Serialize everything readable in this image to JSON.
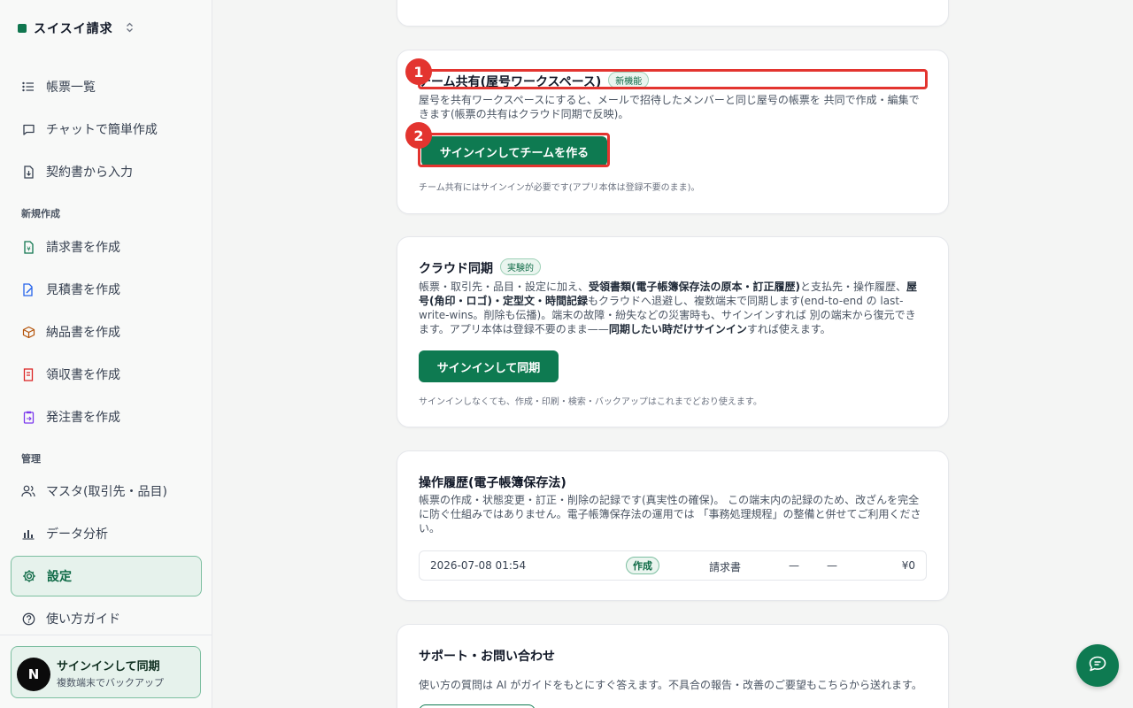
{
  "brand": {
    "name": "スイスイ請求",
    "chevron": "⌃⌄"
  },
  "sidebar": {
    "items": [
      {
        "label": "帳票一覧",
        "icon": "list-icon"
      },
      {
        "label": "チャットで簡単作成",
        "icon": "chat-icon"
      },
      {
        "label": "契約書から入力",
        "icon": "document-import-icon"
      }
    ],
    "section_new": "新規作成",
    "new_items": [
      {
        "label": "請求書を作成",
        "icon": "invoice-icon"
      },
      {
        "label": "見積書を作成",
        "icon": "quote-icon"
      },
      {
        "label": "納品書を作成",
        "icon": "box-icon"
      },
      {
        "label": "領収書を作成",
        "icon": "receipt-icon"
      },
      {
        "label": "発注書を作成",
        "icon": "order-icon"
      }
    ],
    "section_manage": "管理",
    "manage_items": [
      {
        "label": "マスタ(取引先・品目)",
        "icon": "users-icon"
      },
      {
        "label": "データ分析",
        "icon": "bar-chart-icon"
      },
      {
        "label": "設定",
        "icon": "gear-icon",
        "active": true
      },
      {
        "label": "使い方ガイド",
        "icon": "help-icon"
      }
    ],
    "signin": {
      "avatar": "N",
      "title": "サインインして同期",
      "subtitle": "複数端末でバックアップ"
    }
  },
  "team_card": {
    "title": "チーム共有(屋号ワークスペース)",
    "badge": "新機能",
    "desc": "屋号を共有ワークスペースにすると、メールで招待したメンバーと同じ屋号の帳票を 共同で作成・編集できます(帳票の共有はクラウド同期で反映)。",
    "button": "サインインしてチームを作る",
    "note": "チーム共有にはサインインが必要です(アプリ本体は登録不要のまま)。",
    "markers": [
      "1",
      "2"
    ]
  },
  "cloud_card": {
    "title": "クラウド同期",
    "badge": "実験的",
    "desc_parts": [
      "帳票・取引先・品目・設定に加え、",
      "受領書類(電子帳簿保存法の原本・訂正履歴)",
      "と支払先・操作履歴、",
      "屋号(角印・ロゴ)・定型文・時間記録",
      "もクラウドへ退避し、複数端末で同期します(end-to-end の last-write-wins。削除も伝播)。端末の故障・紛失などの災害時も、サインインすれば 別の端末から復元できます。アプリ本体は登録不要のまま——",
      "同期したい時だけサインイン",
      "すれば使えます。"
    ],
    "button": "サインインして同期",
    "note": "サインインしなくても、作成・印刷・検索・バックアップはこれまでどおり使えます。"
  },
  "log_card": {
    "title": "操作履歴(電子帳簿保存法)",
    "desc": "帳票の作成・状態変更・訂正・削除の記録です(真実性の確保)。 この端末内の記録のため、改ざんを完全に防ぐ仕組みではありません。電子帳簿保存法の運用では 「事務処理規程」の整備と併せてご利用ください。",
    "rows": [
      {
        "datetime": "2026-07-08 01:54",
        "action": "作成",
        "doc_type": "請求書",
        "col1": "—",
        "col2": "—",
        "amount": "¥0"
      }
    ]
  },
  "support_card": {
    "title": "サポート・お問い合わせ",
    "desc": "使い方の質問は AI がガイドをもとにすぐ答えます。不具合の報告・改善のご要望もこちらから送れます。"
  },
  "colors": {
    "accent": "#0e7a51",
    "highlight": "#e3342f"
  }
}
